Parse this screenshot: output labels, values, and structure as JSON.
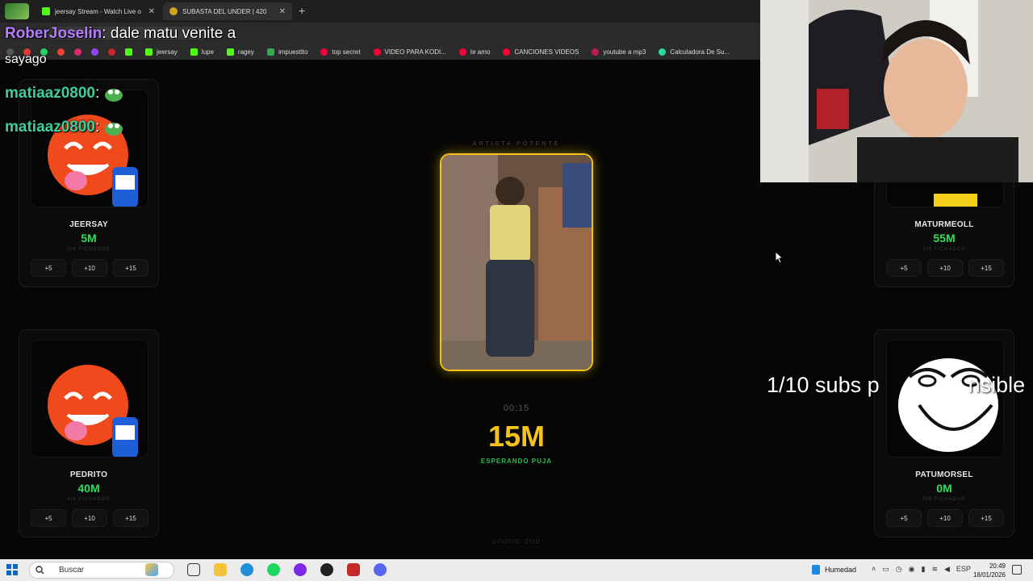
{
  "browser": {
    "tabs": [
      {
        "title": "jeersay Stream - Watch Live o",
        "color": "#53fc18"
      },
      {
        "title": "SUBASTA DEL UNDER | 420",
        "color": "#d6a21a"
      }
    ],
    "new_tab_label": "+",
    "address": "https://jeersay...",
    "bookmarks": [
      {
        "label": "",
        "color": "#e53935"
      },
      {
        "label": "jeersay",
        "color": "#53fc18"
      },
      {
        "label": "lupe",
        "color": "#53fc18"
      },
      {
        "label": "ragey",
        "color": "#53fc18"
      },
      {
        "label": "impuestito",
        "color": "#35a853"
      },
      {
        "label": "top secret",
        "color": "#ff0033"
      },
      {
        "label": "VIDEO PARA KODI...",
        "color": "#ff0033"
      },
      {
        "label": "te amo",
        "color": "#ff0033"
      },
      {
        "label": "CANCIONES VIDEOS",
        "color": "#ff0033"
      },
      {
        "label": "youtube a mp3",
        "color": "#c2185b"
      },
      {
        "label": "Calculadora De Su...",
        "color": "#2bd99f"
      }
    ]
  },
  "chat": [
    {
      "user": "RoberJoselin",
      "sep": ":",
      "message": " dale matu venite a",
      "cont": "sayago"
    },
    {
      "user": "matiaaz0800",
      "sep": ":",
      "message": ""
    },
    {
      "user": "matiaaz0800",
      "sep": ":",
      "message": ""
    }
  ],
  "center": {
    "label": "ARTISTA POTENTE",
    "timer": "00:15",
    "bid": "15M",
    "status": "ESPERANDO PUJA",
    "code": "CÓDIGO: Z0ID"
  },
  "teams": [
    {
      "name": "JEERSAY",
      "amount": "5M",
      "fichados": "0/6 FICHADOS",
      "avatar": "mascot"
    },
    {
      "name": "MATURMEOLL",
      "amount": "55M",
      "fichados": "3/6 FICHADOS",
      "avatar": "yellow"
    },
    {
      "name": "PEDRITO",
      "amount": "40M",
      "fichados": "4/6 FICHADOS",
      "avatar": "mascot"
    },
    {
      "name": "PATUMORSEL",
      "amount": "0M",
      "fichados": "5/6 FICHADOS",
      "avatar": "meme"
    }
  ],
  "bid_buttons": [
    "+5",
    "+10",
    "+15"
  ],
  "overlay": {
    "subs_text": "1/10 subs p",
    "subs_text_end": "nsible"
  },
  "taskbar": {
    "search_placeholder": "Buscar",
    "weather": "Humedad",
    "lang": "ESP",
    "time": "20:49",
    "date": "18/01/2026"
  },
  "colors": {
    "accent_gold": "#f4c21a",
    "accent_green": "#2de05a",
    "kick_green": "#53fc18"
  }
}
